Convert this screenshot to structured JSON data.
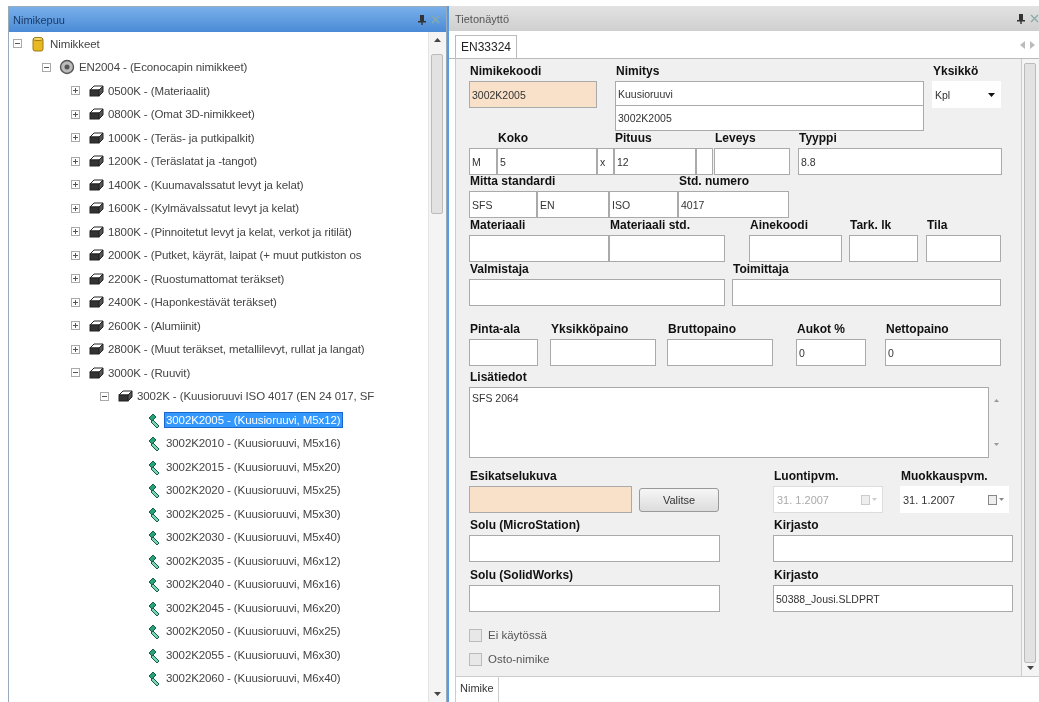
{
  "tree_panel": {
    "title": "Nimikepuu",
    "tree": [
      {
        "label": "Nimikkeet",
        "kind": "root",
        "expanded": true,
        "selected": false,
        "children": [
          {
            "label": "EN2004 - (Econocapin nimikkeet)",
            "kind": "catalog",
            "expanded": true,
            "selected": false,
            "children": [
              {
                "label": "0500K - (Materiaalit)",
                "kind": "group",
                "expanded": false,
                "selected": false
              },
              {
                "label": "0800K - (Omat 3D-nimikkeet)",
                "kind": "group",
                "expanded": false,
                "selected": false
              },
              {
                "label": "1000K - (Teräs- ja putkipalkit)",
                "kind": "group",
                "expanded": false,
                "selected": false
              },
              {
                "label": "1200K - (Teräslatat ja -tangot)",
                "kind": "group",
                "expanded": false,
                "selected": false
              },
              {
                "label": "1400K - (Kuumavalssatut levyt ja kelat)",
                "kind": "group",
                "expanded": false,
                "selected": false
              },
              {
                "label": "1600K - (Kylmävalssatut levyt ja kelat)",
                "kind": "group",
                "expanded": false,
                "selected": false
              },
              {
                "label": "1800K - (Pinnoitetut levyt ja kelat, verkot ja ritilät)",
                "kind": "group",
                "expanded": false,
                "selected": false
              },
              {
                "label": "2000K - (Putket, käyrät, laipat (+ muut putkiston os",
                "kind": "group",
                "expanded": false,
                "selected": false
              },
              {
                "label": "2200K - (Ruostumattomat teräkset)",
                "kind": "group",
                "expanded": false,
                "selected": false
              },
              {
                "label": "2400K - (Haponkestävät teräkset)",
                "kind": "group",
                "expanded": false,
                "selected": false
              },
              {
                "label": "2600K - (Alumiinit)",
                "kind": "group",
                "expanded": false,
                "selected": false
              },
              {
                "label": "2800K - (Muut teräkset, metallilevyt, rullat ja langat)",
                "kind": "group",
                "expanded": false,
                "selected": false
              },
              {
                "label": "3000K - (Ruuvit)",
                "kind": "group",
                "expanded": true,
                "selected": false,
                "children": [
                  {
                    "label": "3002K - (Kuusioruuvi ISO 4017 (EN 24 017, SF",
                    "kind": "group",
                    "expanded": true,
                    "selected": false,
                    "children": [
                      {
                        "label": "3002K2005 - (Kuusioruuvi, M5x12)",
                        "kind": "part",
                        "selected": true
                      },
                      {
                        "label": "3002K2010 - (Kuusioruuvi, M5x16)",
                        "kind": "part",
                        "selected": false
                      },
                      {
                        "label": "3002K2015 - (Kuusioruuvi, M5x20)",
                        "kind": "part",
                        "selected": false
                      },
                      {
                        "label": "3002K2020 - (Kuusioruuvi, M5x25)",
                        "kind": "part",
                        "selected": false
                      },
                      {
                        "label": "3002K2025 - (Kuusioruuvi, M5x30)",
                        "kind": "part",
                        "selected": false
                      },
                      {
                        "label": "3002K2030 - (Kuusioruuvi, M5x40)",
                        "kind": "part",
                        "selected": false
                      },
                      {
                        "label": "3002K2035 - (Kuusioruuvi, M6x12)",
                        "kind": "part",
                        "selected": false
                      },
                      {
                        "label": "3002K2040 - (Kuusioruuvi, M6x16)",
                        "kind": "part",
                        "selected": false
                      },
                      {
                        "label": "3002K2045 - (Kuusioruuvi, M6x20)",
                        "kind": "part",
                        "selected": false
                      },
                      {
                        "label": "3002K2050 - (Kuusioruuvi, M6x25)",
                        "kind": "part",
                        "selected": false
                      },
                      {
                        "label": "3002K2055 - (Kuusioruuvi, M6x30)",
                        "kind": "part",
                        "selected": false
                      },
                      {
                        "label": "3002K2060 - (Kuusioruuvi, M6x40)",
                        "kind": "part",
                        "selected": false
                      }
                    ]
                  }
                ]
              }
            ]
          }
        ]
      }
    ]
  },
  "detail_panel": {
    "title": "Tietonäyttö",
    "tabs": [
      {
        "label": "EN33324",
        "selected": true
      }
    ],
    "form": {
      "rows": [
        {
          "items": [
            {
              "kind": "key",
              "label": "Nimikekoodi",
              "value": "3002K2005"
            },
            {
              "kind": "multiline",
              "label": "Nimitys",
              "lines": [
                "Kuusioruuvi",
                "3002K2005"
              ]
            },
            {
              "kind": "dropdown",
              "label": "Yksikkö",
              "value": "Kpl"
            }
          ]
        },
        {
          "items": [
            {
              "kind": "text",
              "value": "M"
            },
            {
              "kind": "text",
              "label": "Koko",
              "value": "5"
            },
            {
              "kind": "sep",
              "value": "x"
            },
            {
              "kind": "text",
              "label": "Pituus",
              "value": "12"
            },
            {
              "kind": "text"
            },
            {
              "kind": "text",
              "label": "Leveys"
            },
            {
              "kind": "text",
              "label": "Tyyppi",
              "value": "8.8"
            }
          ]
        },
        {
          "items": [
            {
              "kind": "text",
              "label": "Mitta standardi",
              "value": "SFS"
            },
            {
              "kind": "text",
              "value": "EN"
            },
            {
              "kind": "text",
              "value": "ISO"
            },
            {
              "kind": "text",
              "label": "Std. numero",
              "value": "4017"
            }
          ]
        },
        {
          "items": [
            {
              "kind": "text",
              "label": "Materiaali"
            },
            {
              "kind": "text",
              "label": "Materiaali std."
            },
            {
              "kind": "text",
              "label": "Ainekoodi"
            },
            {
              "kind": "text",
              "label": "Tark. lk"
            },
            {
              "kind": "text",
              "label": "Tila"
            }
          ]
        },
        {
          "items": [
            {
              "kind": "text",
              "label": "Valmistaja"
            },
            {
              "kind": "text",
              "label": "Toimittaja"
            }
          ]
        },
        {
          "items": [
            {
              "kind": "text",
              "label": "Pinta-ala"
            },
            {
              "kind": "text",
              "label": "Yksikköpaino"
            },
            {
              "kind": "text",
              "label": "Bruttopaino"
            },
            {
              "kind": "text",
              "label": "Aukot %",
              "value": "0"
            },
            {
              "kind": "text",
              "label": "Nettopaino",
              "value": "0"
            }
          ]
        },
        {
          "items": [
            {
              "kind": "textarea",
              "label": "Lisätiedot",
              "value": "SFS 2064"
            }
          ]
        },
        {
          "items": [
            {
              "kind": "key",
              "label": "Esikatselukuva"
            },
            {
              "kind": "button",
              "text": "Valitse"
            },
            {
              "kind": "date",
              "label": "Luontipvm.",
              "value": "31. 1.2007",
              "disabled": true
            },
            {
              "kind": "date",
              "label": "Muokkauspvm.",
              "value": "31. 1.2007",
              "disabled": false
            }
          ]
        },
        {
          "items": [
            {
              "kind": "text",
              "label": "Solu (MicroStation)"
            },
            {
              "kind": "text",
              "label": "Kirjasto"
            }
          ]
        },
        {
          "items": [
            {
              "kind": "text",
              "label": "Solu (SolidWorks)"
            },
            {
              "kind": "text",
              "label": "Kirjasto",
              "value": "50388_Jousi.SLDPRT"
            }
          ]
        }
      ]
    },
    "checkboxes": [
      {
        "label": "Ei käytössä",
        "checked": false
      },
      {
        "label": "Osto-nimike",
        "checked": false
      }
    ],
    "bottom_tabs": [
      {
        "label": "Nimike",
        "selected": true
      }
    ]
  }
}
